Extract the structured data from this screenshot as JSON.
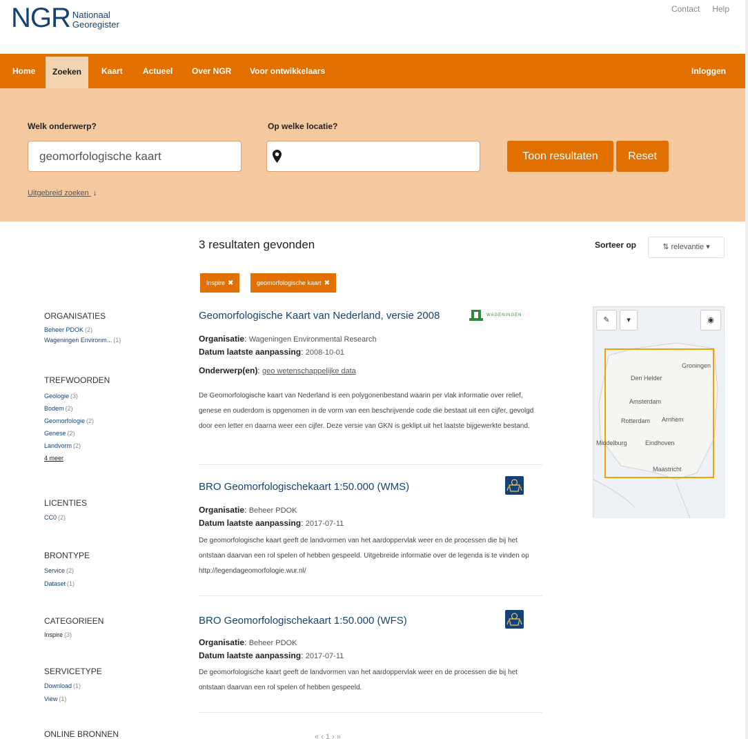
{
  "header": {
    "logo_big": "NGR",
    "logo_line1": "Nationaal",
    "logo_line2": "Georegister",
    "links": [
      "Contact",
      "Help"
    ]
  },
  "nav": {
    "items": [
      "Home",
      "Zoeken",
      "Kaart",
      "Actueel",
      "Over NGR",
      "Voor ontwikkelaars"
    ],
    "active": "Zoeken",
    "login": "Inloggen"
  },
  "search": {
    "subject_label": "Welk onderwerp?",
    "subject_value": "geomorfologische kaart",
    "location_label": "Op welke locatie?",
    "location_value": "",
    "show_button": "Toon resultaten",
    "reset_button": "Reset",
    "advanced_link": "Uitgebreid zoeken"
  },
  "results_header": {
    "count_text": "3 resultaten gevonden",
    "sort_label": "Sorteer op",
    "sort_value": "relevantie",
    "tags": [
      "Inspire",
      "geomorfologische kaart"
    ]
  },
  "facets": [
    {
      "title": "ORGANISATIES",
      "items": [
        {
          "label": "Beheer PDOK",
          "count": "(2)"
        },
        {
          "label": "Wageningen Environm...",
          "count": "(1)"
        }
      ]
    },
    {
      "title": "TREFWOORDEN",
      "items": [
        {
          "label": "Geologie",
          "count": "(3)"
        },
        {
          "label": "Bodem",
          "count": "(2)"
        },
        {
          "label": "Geomorfologie",
          "count": "(2)"
        },
        {
          "label": "Genese",
          "count": "(2)"
        },
        {
          "label": "Landvorm",
          "count": "(2)"
        }
      ],
      "more": "4 meer"
    },
    {
      "title": "LICENTIES",
      "items": [
        {
          "label": "CC0",
          "count": "(2)"
        }
      ]
    },
    {
      "title": "BRONTYPE",
      "items": [
        {
          "label": "Service",
          "count": "(2)"
        },
        {
          "label": "Dataset",
          "count": "(1)"
        }
      ]
    },
    {
      "title": "CATEGORIEEN",
      "items": [
        {
          "label": "Inspire",
          "count": "(3)"
        }
      ]
    },
    {
      "title": "SERVICETYPE",
      "items": [
        {
          "label": "Download",
          "count": "(1)"
        },
        {
          "label": "View",
          "count": "(1)"
        }
      ]
    },
    {
      "title": "ONLINE BRONNEN",
      "items": []
    }
  ],
  "results": [
    {
      "title": "Geomorfologische Kaart van Nederland, versie 2008",
      "org_label": "Organisatie",
      "org": "Wageningen Environmental Research",
      "date_label": "Datum laatste aanpassing",
      "date": "2008-10-01",
      "subject_label": "Onderwerp(en)",
      "subject": "geo wetenschappelijke data",
      "description": "De Geomorfologische kaart van Nederland is een polygonenbestand waarin per vlak informatie over relief, genese en ouderdom is opgenomen in de vorm van een beschrijvende code die bestaat uit een cijfer, gevolgd door een letter en daarna weer een cijfer. Deze versie van GKN is geklipt uit het laatste bijgewerkte bestand.",
      "logo_text": "WAGENINGEN"
    },
    {
      "title": "BRO Geomorfologischekaart 1:50.000 (WMS)",
      "org_label": "Organisatie",
      "org": "Beheer PDOK",
      "date_label": "Datum laatste aanpassing",
      "date": "2017-07-11",
      "description": "De geomorfologische kaart geeft de landvormen van het aardoppervlak weer en de processen die bij het ontstaan daarvan een rol spelen of hebben gespeeld. Uitgebreide informatie over de legenda is te vinden op http://legendageomorfologie.wur.nl/"
    },
    {
      "title": "BRO Geomorfologischekaart 1:50.000 (WFS)",
      "org_label": "Organisatie",
      "org": "Beheer PDOK",
      "date_label": "Datum laatste aanpassing",
      "date": "2017-07-11",
      "description": "De geomorfologische kaart geeft de landvormen van het aardoppervlak weer en de processen die bij het ontstaan daarvan een rol spelen of hebben gespeeld."
    }
  ],
  "map": {
    "cities": [
      "Groningen",
      "Den Helder",
      "Amsterdam",
      "Rotterdam",
      "Arnhem",
      "Middelburg",
      "Eindhoven",
      "Maastricht"
    ]
  },
  "pager": {
    "text": "« ‹ 1 › »"
  },
  "colors": {
    "brand_orange": "#e17000",
    "search_bg": "#f4c9a0",
    "link_blue": "#154273"
  }
}
